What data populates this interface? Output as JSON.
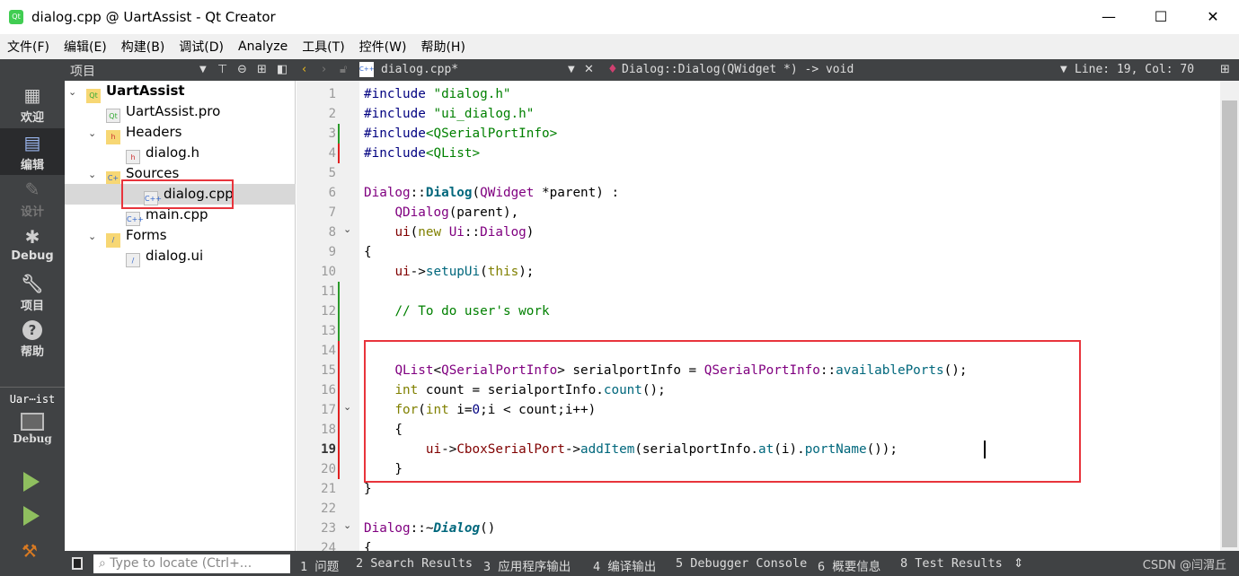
{
  "window": {
    "title": "dialog.cpp @ UartAssist - Qt Creator",
    "minimize": "—",
    "maximize": "☐",
    "close": "✕"
  },
  "menu": [
    "文件(F)",
    "编辑(E)",
    "构建(B)",
    "调试(D)",
    "Analyze",
    "工具(T)",
    "控件(W)",
    "帮助(H)"
  ],
  "modes": [
    {
      "label": "欢迎",
      "icon": "grid-icon"
    },
    {
      "label": "编辑",
      "icon": "edit-icon",
      "active": true
    },
    {
      "label": "设计",
      "icon": "pencil-icon",
      "disabled": true
    },
    {
      "label": "Debug",
      "icon": "bug-icon"
    },
    {
      "label": "项目",
      "icon": "wrench-icon"
    },
    {
      "label": "帮助",
      "icon": "help-icon"
    }
  ],
  "kit": {
    "project": "Uar⋯ist",
    "build": "Debug"
  },
  "project_panel": {
    "title": "项目"
  },
  "tree": [
    {
      "label": "UartAssist",
      "level": 0,
      "expanded": true,
      "bold": true,
      "icon": "qt-project-folder-icon"
    },
    {
      "label": "UartAssist.pro",
      "level": 1,
      "icon": "pro-file-icon"
    },
    {
      "label": "Headers",
      "level": 1,
      "expanded": true,
      "icon": "headers-folder-icon"
    },
    {
      "label": "dialog.h",
      "level": 2,
      "icon": "header-file-icon"
    },
    {
      "label": "Sources",
      "level": 1,
      "expanded": true,
      "icon": "sources-folder-icon"
    },
    {
      "label": "dialog.cpp",
      "level": 2,
      "icon": "cpp-file-icon",
      "selected": true
    },
    {
      "label": "main.cpp",
      "level": 2,
      "icon": "cpp-file-icon"
    },
    {
      "label": "Forms",
      "level": 1,
      "expanded": true,
      "icon": "forms-folder-icon"
    },
    {
      "label": "dialog.ui",
      "level": 2,
      "icon": "ui-file-icon"
    }
  ],
  "editor": {
    "file": "dialog.cpp*",
    "symbol": "Dialog::Dialog(QWidget *) -> void",
    "position": "Line: 19, Col: 70",
    "current_line": 19,
    "lines": [
      [
        [
          "#include ",
          "macro"
        ],
        [
          "\"dialog.h\"",
          "str"
        ]
      ],
      [
        [
          "#include ",
          "macro"
        ],
        [
          "\"ui_dialog.h\"",
          "str"
        ]
      ],
      [
        [
          "#include",
          "macro"
        ],
        [
          "<QSerialPortInfo>",
          "str"
        ]
      ],
      [
        [
          "#include",
          "macro"
        ],
        [
          "<QList>",
          "str"
        ]
      ],
      [],
      [
        [
          "Dialog",
          "type"
        ],
        [
          "::",
          ""
        ],
        [
          "Dialog",
          "decl"
        ],
        [
          "(",
          ""
        ],
        [
          "QWidget",
          "type"
        ],
        [
          " *parent) :",
          ""
        ]
      ],
      [
        [
          "    ",
          ""
        ],
        [
          "QDialog",
          "type"
        ],
        [
          "(parent),",
          ""
        ]
      ],
      [
        [
          "    ",
          ""
        ],
        [
          "ui",
          "mem"
        ],
        [
          "(",
          ""
        ],
        [
          "new",
          "kw"
        ],
        [
          " ",
          ""
        ],
        [
          "Ui",
          "type"
        ],
        [
          "::",
          ""
        ],
        [
          "Dialog",
          "type"
        ],
        [
          ")",
          ""
        ]
      ],
      [
        [
          "{",
          ""
        ]
      ],
      [
        [
          "    ",
          ""
        ],
        [
          "ui",
          "mem"
        ],
        [
          "->",
          ""
        ],
        [
          "setupUi",
          "fn"
        ],
        [
          "(",
          ""
        ],
        [
          "this",
          "kw"
        ],
        [
          ");",
          ""
        ]
      ],
      [],
      [
        [
          "    ",
          ""
        ],
        [
          "// To do user's work",
          "com"
        ]
      ],
      [],
      [],
      [
        [
          "    ",
          ""
        ],
        [
          "QList",
          "type"
        ],
        [
          "<",
          ""
        ],
        [
          "QSerialPortInfo",
          "type"
        ],
        [
          "> serialportInfo = ",
          ""
        ],
        [
          "QSerialPortInfo",
          "type"
        ],
        [
          "::",
          ""
        ],
        [
          "availablePorts",
          "fn"
        ],
        [
          "();",
          ""
        ]
      ],
      [
        [
          "    ",
          ""
        ],
        [
          "int",
          "kw"
        ],
        [
          " count = serialportInfo.",
          ""
        ],
        [
          "count",
          "fn"
        ],
        [
          "();",
          ""
        ]
      ],
      [
        [
          "    ",
          ""
        ],
        [
          "for",
          "kw"
        ],
        [
          "(",
          ""
        ],
        [
          "int",
          "kw"
        ],
        [
          " i=",
          ""
        ],
        [
          "0",
          "num"
        ],
        [
          ";i < count;i++)",
          ""
        ]
      ],
      [
        [
          "    {",
          ""
        ]
      ],
      [
        [
          "        ",
          ""
        ],
        [
          "ui",
          "mem"
        ],
        [
          "->",
          ""
        ],
        [
          "CboxSerialPort",
          "mem"
        ],
        [
          "->",
          ""
        ],
        [
          "addItem",
          "fn"
        ],
        [
          "(serialportInfo.",
          ""
        ],
        [
          "at",
          "fn"
        ],
        [
          "(i).",
          ""
        ],
        [
          "portName",
          "fn"
        ],
        [
          "());",
          ""
        ]
      ],
      [
        [
          "    }",
          ""
        ]
      ],
      [
        [
          "}",
          ""
        ]
      ],
      [],
      [
        [
          "Dialog",
          "type"
        ],
        [
          "::~",
          ""
        ],
        [
          "Dialog",
          "decli"
        ],
        [
          "()",
          ""
        ]
      ],
      [
        [
          "{",
          ""
        ]
      ]
    ],
    "folds": [
      8,
      17,
      23
    ],
    "added_lines": [
      3,
      11,
      12,
      13
    ],
    "modified_lines": [
      4,
      14,
      15,
      16,
      17,
      18,
      19,
      20
    ]
  },
  "status": {
    "locator_placeholder": "Type to locate (Ctrl+...",
    "panes": [
      "1 问题",
      "2 Search Results",
      "3 应用程序输出",
      "4 编译输出",
      "5 Debugger Console",
      "6 概要信息",
      "8 Test Results"
    ],
    "watermark": "CSDN @闫渭丘"
  }
}
